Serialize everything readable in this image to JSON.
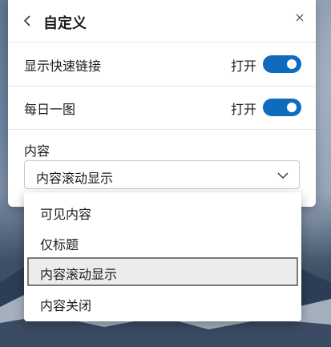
{
  "panel": {
    "title": "自定义",
    "back_icon": "back-arrow-icon",
    "close_icon": "close-icon"
  },
  "settings": {
    "quick_links": {
      "label": "显示快速链接",
      "state": "打开",
      "on": true
    },
    "daily_image": {
      "label": "每日一图",
      "state": "打开",
      "on": true
    }
  },
  "content": {
    "label": "内容",
    "selected": "内容滚动显示",
    "options": [
      "可见内容",
      "仅标题",
      "内容滚动显示",
      "内容关闭"
    ],
    "selected_index": 2
  },
  "colors": {
    "accent": "#0f6cbd"
  }
}
